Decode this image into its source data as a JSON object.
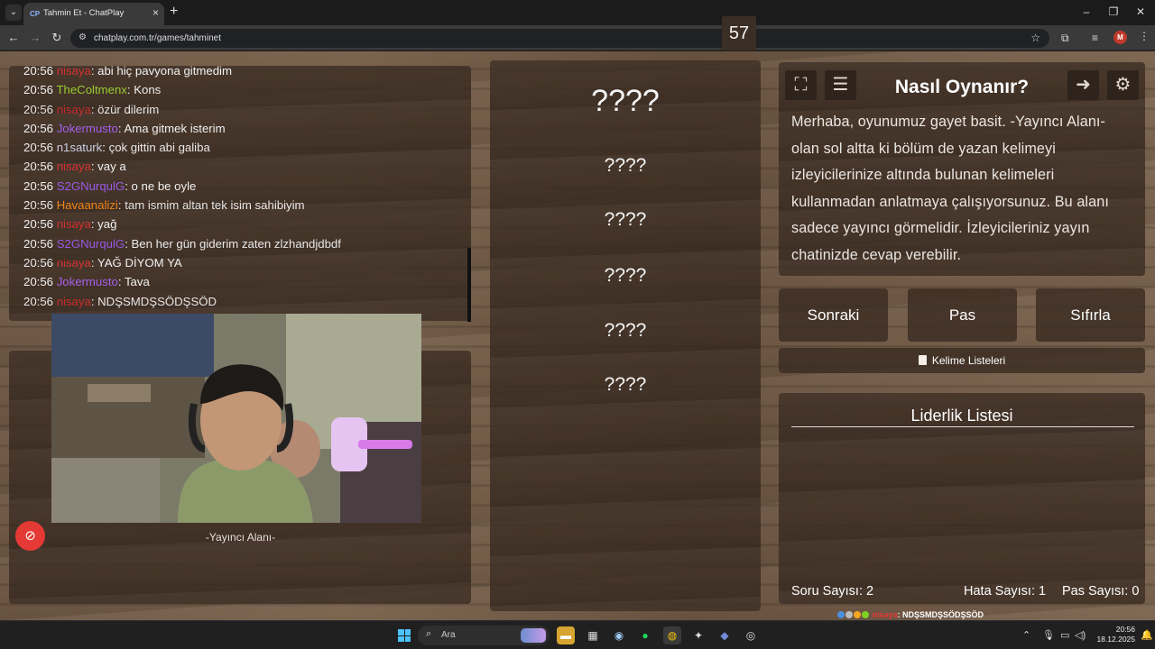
{
  "browser": {
    "tab_favicon": "CP",
    "tab_title": "Tahmin Et - ChatPlay",
    "url": "chatplay.com.tr/games/tahminet",
    "profile_initial": "M"
  },
  "chat": {
    "messages": [
      {
        "time": "20:56",
        "user": "nisaya",
        "color": "#d32f2f",
        "text": "abi hiç pavyona gitmedim"
      },
      {
        "time": "20:56",
        "user": "TheColtmenx",
        "color": "#9acd32",
        "text": "Kons"
      },
      {
        "time": "20:56",
        "user": "nisaya",
        "color": "#d32f2f",
        "text": "özür dilerim"
      },
      {
        "time": "20:56",
        "user": "Jokermusto",
        "color": "#a55eea",
        "text": "Ama gitmek isterim"
      },
      {
        "time": "20:56",
        "user": "n1saturk",
        "color": "#cfd3ea",
        "text": "çok gittin abi galiba"
      },
      {
        "time": "20:56",
        "user": "nisaya",
        "color": "#d32f2f",
        "text": "vay a"
      },
      {
        "time": "20:56",
        "user": "S2GNurqulG",
        "color": "#9b59e6",
        "text": "o ne be oyle"
      },
      {
        "time": "20:56",
        "user": "Havaanalizi",
        "color": "#ff8c1a",
        "text": "tam ismim altan tek isim sahibiyim"
      },
      {
        "time": "20:56",
        "user": "nisaya",
        "color": "#d32f2f",
        "text": "yağ"
      },
      {
        "time": "20:56",
        "user": "S2GNurqulG",
        "color": "#9b59e6",
        "text": "Ben her gün giderim zaten zlzhandjdbdf"
      },
      {
        "time": "20:56",
        "user": "nisaya",
        "color": "#d32f2f",
        "text": "YAĞ DİYOM YA"
      },
      {
        "time": "20:56",
        "user": "Jokermusto",
        "color": "#a55eea",
        "text": "Tava"
      },
      {
        "time": "20:56",
        "user": "nisaya",
        "color": "#d32f2f",
        "text": "NDŞSMDŞSÖDŞSÖD"
      }
    ]
  },
  "streamer": {
    "label": "-Yayıncı Alanı-"
  },
  "game": {
    "timer": "57",
    "words": [
      "????",
      "????",
      "????",
      "????",
      "????",
      "????"
    ]
  },
  "howto": {
    "title": "Nasıl Oynanır?",
    "body": "Merhaba, oyunumuz gayet basit. -Yayıncı Alanı- olan sol altta ki bölüm de yazan kelimeyi izleyicilerinize altında bulunan kelimeleri kullanmadan anlatmaya çalışıyorsunuz. Bu alanı sadece yayıncı görmelidir. İzleyicileriniz yayın chatinizde cevap verebilir."
  },
  "actions": {
    "next": "Sonraki",
    "pass": "Pas",
    "reset": "Sıfırla",
    "word_lists": "Kelime Listeleri"
  },
  "leaderboard": {
    "title": "Liderlik Listesi",
    "question_count": "Soru Sayısı: 2",
    "error_count": "Hata Sayısı: 1",
    "pass_count": "Pas Sayısı: 0"
  },
  "ticker": {
    "user": "nisaya",
    "text": ": NDŞSMDŞSÖDŞSÖD"
  },
  "taskbar": {
    "search_placeholder": "Ara",
    "time": "20:56",
    "date": "18.12.2025"
  }
}
